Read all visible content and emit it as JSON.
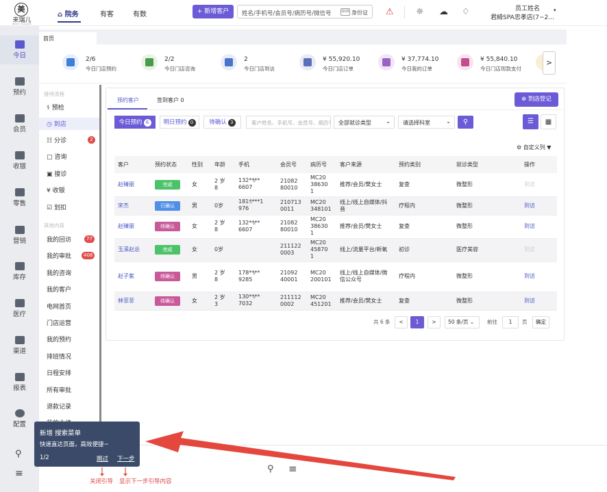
{
  "app": {
    "logo_char": "美",
    "logo_name": "来瑞儿",
    "logo_sub": "BEAUTY ALLIANCE"
  },
  "topnav": [
    {
      "label": "院务",
      "active": true
    },
    {
      "label": "有客",
      "active": false
    },
    {
      "label": "有数",
      "active": false
    }
  ],
  "add_customer": "+ 新增客户",
  "search": {
    "placeholder": "姓名/手机号/会员号/病历号/微信号",
    "id_label": "身份证",
    "kbd": "OCR"
  },
  "user": {
    "name": "员工姓名",
    "store": "君綺SPA忠孝店(7~2..."
  },
  "sidebar": [
    {
      "label": "今日",
      "icon": "chart-icon",
      "active": true
    },
    {
      "label": "预约",
      "icon": "calendar-icon"
    },
    {
      "label": "会员",
      "icon": "member-icon"
    },
    {
      "label": "收银",
      "icon": "cashier-icon"
    },
    {
      "label": "零售",
      "icon": "bag-icon"
    },
    {
      "label": "营销",
      "icon": "bookmark-icon"
    },
    {
      "label": "库存",
      "icon": "inventory-icon"
    },
    {
      "label": "医疗",
      "icon": "medical-icon"
    },
    {
      "label": "渠道",
      "icon": "channel-icon"
    },
    {
      "label": "报表",
      "icon": "report-icon"
    },
    {
      "label": "配置",
      "icon": "settings-icon"
    }
  ],
  "page_tab": "首页",
  "stats": [
    {
      "value": "2/6",
      "label": "今日门店预约",
      "color": "#3d7fd9",
      "bg": "#e6effb"
    },
    {
      "value": "2/2",
      "label": "今日门店咨询",
      "color": "#4a9a4e",
      "bg": "#e7f3e3"
    },
    {
      "value": "2",
      "label": "今日门店到访",
      "color": "#4a74c9",
      "bg": "#e6ecf8"
    },
    {
      "value": "¥ 55,920.10",
      "label": "今日门店订单",
      "color": "#5a6fb8",
      "bg": "#e8ebf6"
    },
    {
      "value": "¥ 37,774.10",
      "label": "今日我的订单",
      "color": "#9a63c2",
      "bg": "#f1e6f7"
    },
    {
      "value": "¥ 55,840.10",
      "label": "今日门店现款支付",
      "color": "#c24c8e",
      "bg": "#f8e4ef"
    }
  ],
  "left_panel": {
    "section1": "接待流程",
    "flow": [
      {
        "label": "预检",
        "icon": "stethoscope-icon"
      },
      {
        "label": "到店",
        "icon": "clock-icon",
        "active": true
      },
      {
        "label": "分诊",
        "icon": "triage-icon",
        "badge": "2"
      },
      {
        "label": "咨询",
        "icon": "chat-icon"
      },
      {
        "label": "接诊",
        "icon": "reception-icon"
      },
      {
        "label": "收银",
        "icon": "yen-icon"
      },
      {
        "label": "划扣",
        "icon": "deduct-icon"
      }
    ],
    "section2": "其他内容",
    "others": [
      {
        "label": "我的回访",
        "badge": "77"
      },
      {
        "label": "我的审批",
        "badge": "408"
      },
      {
        "label": "我的咨询"
      },
      {
        "label": "我的客户"
      },
      {
        "label": "电网首页"
      },
      {
        "label": "门店运营"
      },
      {
        "label": "我的预约"
      },
      {
        "label": "排班情况"
      },
      {
        "label": "日程安排"
      },
      {
        "label": "所有审批"
      },
      {
        "label": "退款记录"
      },
      {
        "label": "我的业绩"
      }
    ]
  },
  "main": {
    "tabs": [
      "预约客户",
      "签到客户 0"
    ],
    "register_btn": "到店登记",
    "segments": [
      {
        "label": "今日预约",
        "count": "6"
      },
      {
        "label": "明日预约",
        "count": "0"
      },
      {
        "label": "待确认",
        "count": "3"
      }
    ],
    "filter_placeholder": "客户姓名、手机号、会员号、病历号",
    "select_type": "全部就诊类型",
    "select_dept": "请选择科室",
    "custom_cols": "自定义列 ▼",
    "columns": [
      "客户",
      "预约状态",
      "性别",
      "年龄",
      "手机",
      "会员号",
      "病历号",
      "客户来源",
      "预约类别",
      "就诊类型",
      "操作"
    ],
    "rows": [
      {
        "name": "赵臻丽",
        "status": "完成",
        "status_color": "#4cc36a",
        "gender": "女",
        "age": "2 岁\n8",
        "phone": "132****\n6607",
        "member": "21082\n80010",
        "record": "MC20\n38630\n1",
        "source": "推荐/会员/樊女士",
        "category": "复查",
        "type": "微整形",
        "action": "到访",
        "action_disabled": true
      },
      {
        "name": "宋杰",
        "status": "已确认",
        "status_color": "#4f8fe6",
        "gender": "男",
        "age": "0岁",
        "phone": "181****1\n976",
        "member": "210713\n0011",
        "record": "MC20\n348101",
        "source": "线上/线上自媒体/抖\n音",
        "category": "疗程内",
        "type": "微整形",
        "action": "到访",
        "action_disabled": false
      },
      {
        "name": "赵臻丽",
        "status": "待确认",
        "status_color": "#c85a9a",
        "gender": "女",
        "age": "2 岁\n8",
        "phone": "132****\n6607",
        "member": "21082\n80010",
        "record": "MC20\n38630\n1",
        "source": "推荐/会员/樊女士",
        "category": "复查",
        "type": "微整形",
        "action": "到访",
        "action_disabled": false
      },
      {
        "name": "玉溪赵总",
        "status": "完成",
        "status_color": "#4cc36a",
        "gender": "女",
        "age": "0岁",
        "phone": "",
        "member": "211122\n0003",
        "record": "MC20\n45870\n1",
        "source": "线上/流量平台/新氧",
        "category": "初诊",
        "type": "医疗美容",
        "action": "到访",
        "action_disabled": true
      },
      {
        "name": "赵子紫",
        "status": "待确认",
        "status_color": "#c85a9a",
        "gender": "男",
        "age": "2 岁\n8",
        "phone": "178****\n9285",
        "member": "21092\n40001",
        "record": "MC20\n200101",
        "source": "线上/线上自媒体/微\n信公众号",
        "category": "疗程内",
        "type": "微整形",
        "action": "到访",
        "action_disabled": false
      },
      {
        "name": "林菲菲",
        "status": "待确认",
        "status_color": "#c85a9a",
        "gender": "女",
        "age": "2 岁\n3",
        "phone": "130****\n7032",
        "member": "211112\n0002",
        "record": "MC20\n451201",
        "source": "推荐/会员/樊女士",
        "category": "复查",
        "type": "微整形",
        "action": "到访",
        "action_disabled": false
      }
    ],
    "pagination": {
      "total": "共 6 条",
      "prev": "<",
      "page": "1",
      "next": ">",
      "size": "50 条/页",
      "goto": "前往",
      "goto_val": "1",
      "page_unit": "页",
      "confirm": "确定"
    }
  },
  "tooltip": {
    "title": "新增 搜索菜单",
    "desc": "快速直达页面，高效便捷~",
    "counter": "1/2",
    "skip": "跳过",
    "next": "下一步"
  },
  "annotations": {
    "close": "关闭引导",
    "next": "显示下一步引导内容"
  }
}
